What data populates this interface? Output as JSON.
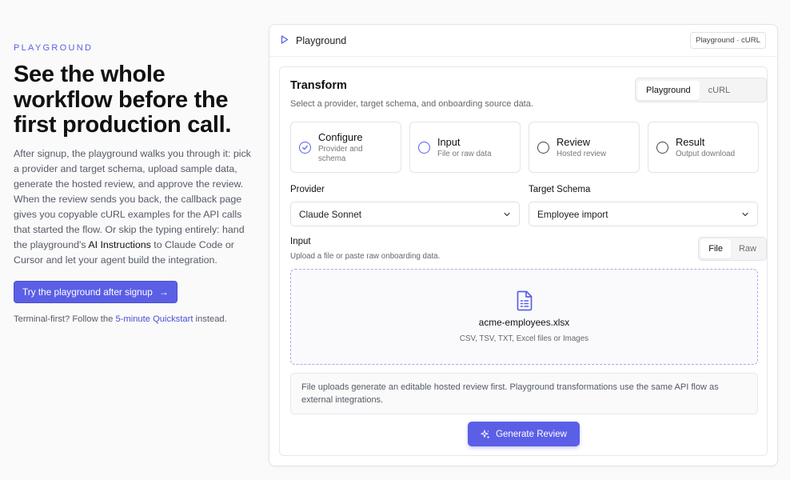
{
  "left": {
    "eyebrow": "PLAYGROUND",
    "headline": "See the whole workflow before the first production call.",
    "body_part1": "After signup, the playground walks you through it: pick a provider and target schema, upload sample data, generate the hosted review, and approve the review. When the review sends you back, the callback page gives you copyable cURL examples for the API calls that started the flow. Or skip the typing entirely: hand the playground's ",
    "body_strong": "AI Instructions",
    "body_part2": " to Claude Code or Cursor and let your agent build the integration.",
    "cta_label": "Try the playground after signup",
    "note_prefix": "Terminal-first? Follow the ",
    "note_link": "5-minute Quickstart",
    "note_suffix": " instead."
  },
  "panel": {
    "title": "Playground",
    "tag": "Playground · cURL"
  },
  "transform": {
    "title": "Transform",
    "subtitle": "Select a provider, target schema, and onboarding source data.",
    "mode_tabs": [
      "Playground",
      "cURL"
    ],
    "mode_active": "Playground"
  },
  "steps": [
    {
      "name": "Configure",
      "desc": "Provider and schema",
      "state": "done"
    },
    {
      "name": "Input",
      "desc": "File or raw data",
      "state": "current"
    },
    {
      "name": "Review",
      "desc": "Hosted review",
      "state": "pending"
    },
    {
      "name": "Result",
      "desc": "Output download",
      "state": "pending"
    }
  ],
  "provider": {
    "label": "Provider",
    "value": "Claude Sonnet"
  },
  "schema": {
    "label": "Target Schema",
    "value": "Employee import"
  },
  "input": {
    "label": "Input",
    "sub": "Upload a file or paste raw onboarding data.",
    "tabs": [
      "File",
      "Raw"
    ],
    "tab_active": "File",
    "file_name": "acme-employees.xlsx",
    "file_types": "CSV, TSV, TXT, Excel files or Images"
  },
  "info_text": "File uploads generate an editable hosted review first. Playground transformations use the same API flow as external integrations.",
  "generate_label": "Generate Review",
  "colors": {
    "accent": "#5b5fe6",
    "border": "#e4e4e7",
    "muted": "#555b66"
  },
  "icons": {
    "panel": "play-icon",
    "cta": "arrow-right-icon",
    "done": "check-icon",
    "file": "file-spreadsheet-icon",
    "generate": "sparkles-icon",
    "select": "chevron-down-icon"
  }
}
